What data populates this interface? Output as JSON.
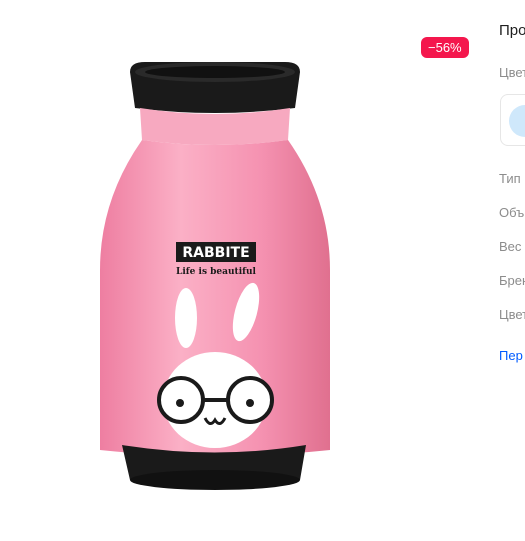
{
  "badge": {
    "discount": "−56%"
  },
  "product_image": {
    "alt": "Pink thermos bottle with bunny",
    "brand_text": "RABBITE",
    "slogan": "Life is  beautiful"
  },
  "info": {
    "title": "Про",
    "color_label": "Цвет",
    "swatch_color": "#cfe8fb",
    "specs": [
      {
        "label": "Тип"
      },
      {
        "label": "Объ"
      },
      {
        "label": "Вес"
      },
      {
        "label": "Брен"
      },
      {
        "label": "Цвет"
      }
    ],
    "link": "Пер"
  },
  "colors": {
    "bottle_pink": "#f59ab5",
    "lid_black": "#1a1a1a",
    "badge_red": "#f4174d",
    "link_blue": "#005bff"
  }
}
